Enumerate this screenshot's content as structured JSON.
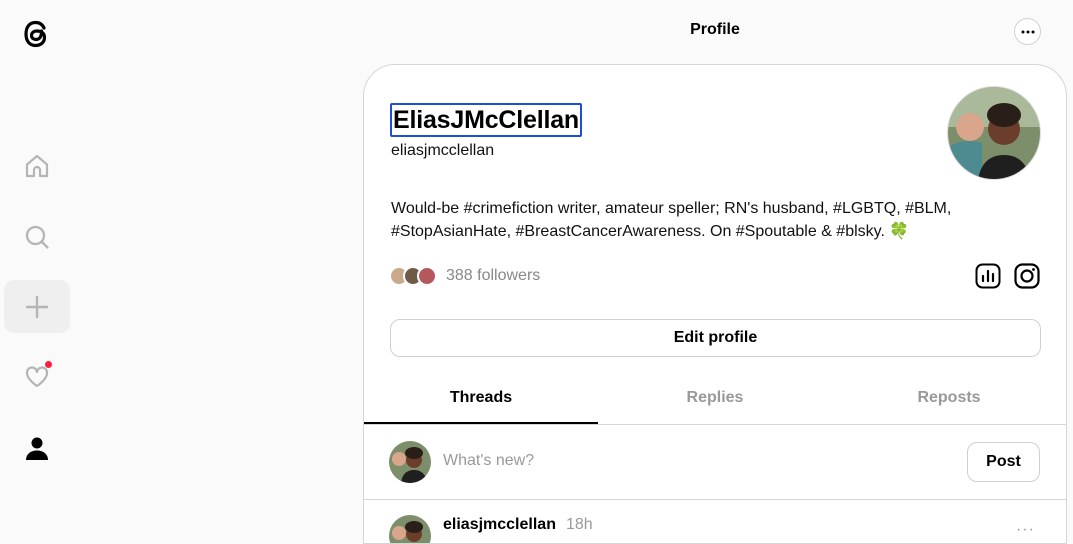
{
  "header": {
    "title": "Profile"
  },
  "profile": {
    "display_name": "EliasJMcClellan",
    "username": "eliasjmcclellan",
    "bio": "Would-be #crimefiction writer, amateur speller; RN's husband, #LGBTQ, #BLM, #StopAsianHate, #BreastCancerAwareness. On #Spoutable & #blsky. 🍀",
    "followers": "388 followers",
    "edit_label": "Edit profile"
  },
  "tabs": [
    {
      "label": "Threads"
    },
    {
      "label": "Replies"
    },
    {
      "label": "Reposts"
    }
  ],
  "composer": {
    "placeholder": "What's new?",
    "post_label": "Post"
  },
  "thread": {
    "username": "eliasjmcclellan",
    "time": "18h",
    "more": "···"
  },
  "colors": {
    "accent": "#000000",
    "notification": "#ff1d3f",
    "focus": "#1d4ed8"
  },
  "icons": [
    "threads-logo",
    "home-icon",
    "search-icon",
    "plus-icon",
    "heart-icon",
    "person-icon",
    "more-icon",
    "insights-icon",
    "instagram-icon"
  ]
}
